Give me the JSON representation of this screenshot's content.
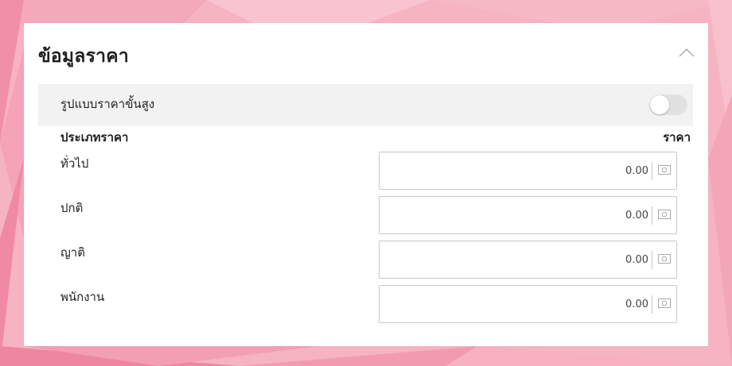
{
  "panel": {
    "title": "ข้อมูลราคา",
    "collapse_icon": "chevron-up-icon"
  },
  "advanced": {
    "label": "รูปแบบราคาขั้นสูง",
    "enabled": false
  },
  "table": {
    "col_type": "ประเภทราคา",
    "col_price": "ราคา",
    "rows": [
      {
        "label": "ทั่วไป",
        "value": "0.00",
        "icon": "money-icon"
      },
      {
        "label": "ปกติ",
        "value": "0.00",
        "icon": "money-icon"
      },
      {
        "label": "ญาติ",
        "value": "0.00",
        "icon": "money-icon"
      },
      {
        "label": "พนักงาน",
        "value": "0.00",
        "icon": "money-icon"
      }
    ]
  },
  "colors": {
    "background": "#f6b3c2",
    "card": "#ffffff",
    "row_highlight": "#f2f2f2",
    "toggle_off": "#e1e1e1"
  }
}
